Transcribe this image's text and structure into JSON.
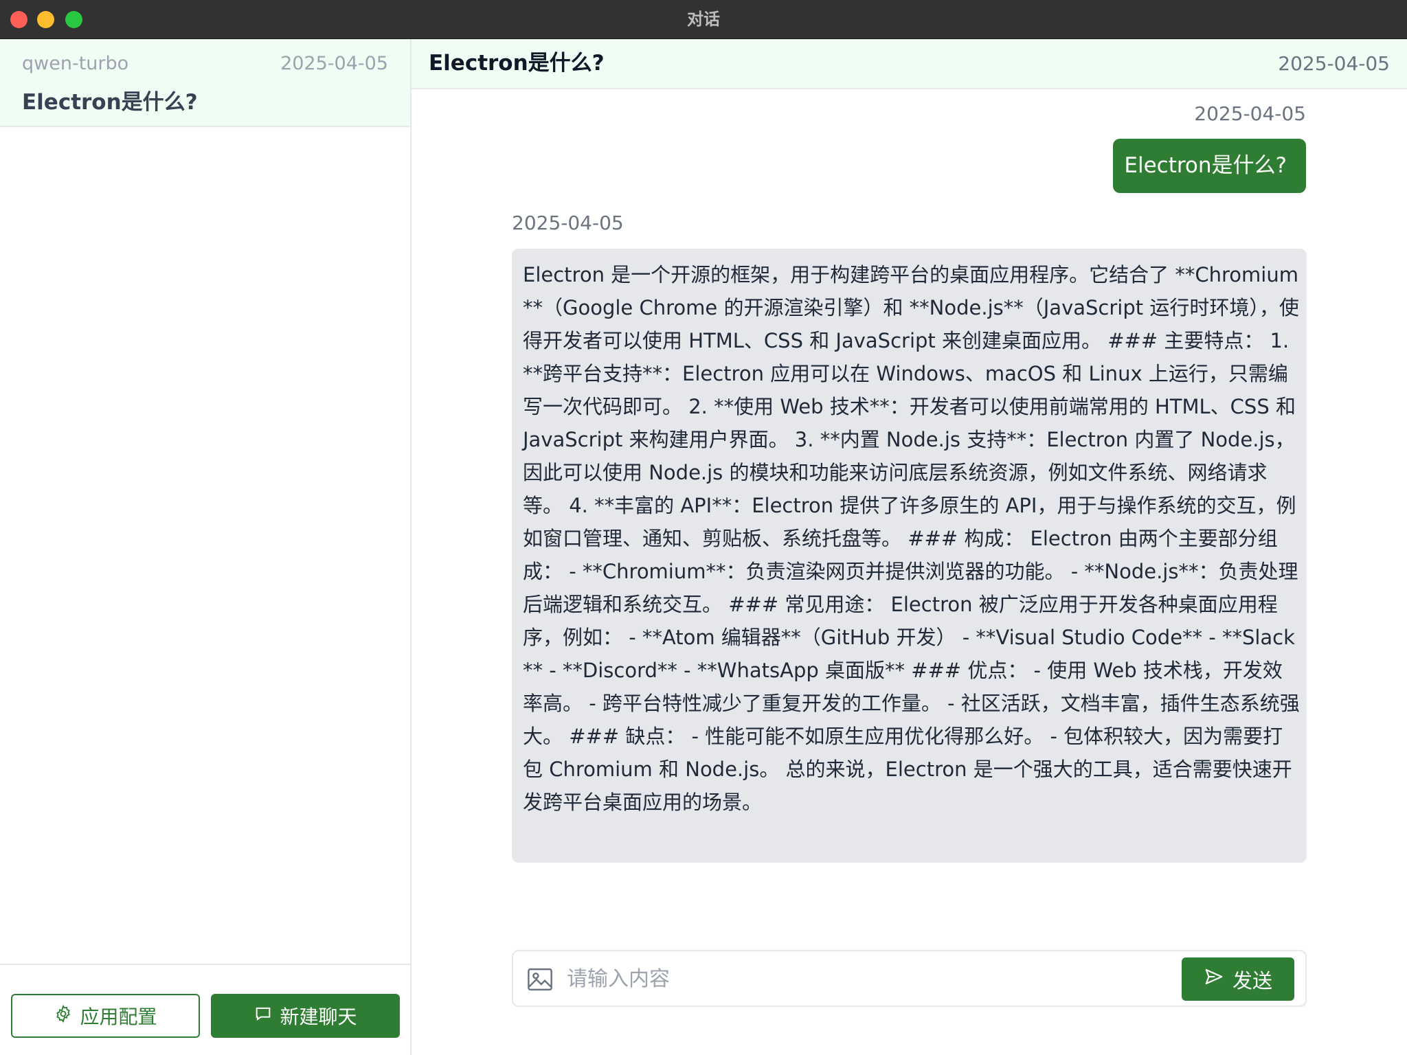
{
  "window": {
    "title": "对话"
  },
  "sidebar": {
    "conversations": [
      {
        "model": "qwen-turbo",
        "date": "2025-04-05",
        "title": "Electron是什么?"
      }
    ],
    "settings_button": "应用配置",
    "new_chat_button": "新建聊天"
  },
  "main": {
    "header": {
      "title": "Electron是什么?",
      "date": "2025-04-05"
    },
    "messages": [
      {
        "role": "user",
        "date": "2025-04-05",
        "text": "Electron是什么?"
      },
      {
        "role": "assistant",
        "date": "2025-04-05",
        "text": "Electron 是一个开源的框架，用于构建跨平台的桌面应用程序。它结合了 **Chromium**（Google Chrome 的开源渲染引擎）和 **Node.js**（JavaScript 运行时环境），使得开发者可以使用 HTML、CSS 和 JavaScript 来创建桌面应用。 ### 主要特点： 1. **跨平台支持**：Electron 应用可以在 Windows、macOS 和 Linux 上运行，只需编写一次代码即可。 2. **使用 Web 技术**：开发者可以使用前端常用的 HTML、CSS 和 JavaScript 来构建用户界面。 3. **内置 Node.js 支持**：Electron 内置了 Node.js，因此可以使用 Node.js 的模块和功能来访问底层系统资源，例如文件系统、网络请求等。 4. **丰富的 API**：Electron 提供了许多原生的 API，用于与操作系统的交互，例如窗口管理、通知、剪贴板、系统托盘等。 ### 构成： Electron 由两个主要部分组成： - **Chromium**：负责渲染网页并提供浏览器的功能。 - **Node.js**：负责处理后端逻辑和系统交互。 ### 常见用途： Electron 被广泛应用于开发各种桌面应用程序，例如： - **Atom 编辑器**（GitHub 开发） - **Visual Studio Code** - **Slack** - **Discord** - **WhatsApp 桌面版** ### 优点： - 使用 Web 技术栈，开发效率高。 - 跨平台特性减少了重复开发的工作量。 - 社区活跃，文档丰富，插件生态系统强大。 ### 缺点： - 性能可能不如原生应用优化得那么好。 - 包体积较大，因为需要打包 Chromium 和 Node.js。 总的来说，Electron 是一个强大的工具，适合需要快速开发跨平台桌面应用的场景。"
      }
    ],
    "input": {
      "placeholder": "请输入内容",
      "value": ""
    },
    "send_button": "发送"
  },
  "colors": {
    "accent": "#2e7d32",
    "header_bg": "#f0fdf4",
    "assistant_bubble": "#e5e7eb",
    "titlebar": "#323232"
  },
  "icons": {
    "settings": "gear-icon",
    "new_chat": "chat-bubble-icon",
    "image_upload": "image-icon",
    "send": "paper-plane-icon"
  }
}
